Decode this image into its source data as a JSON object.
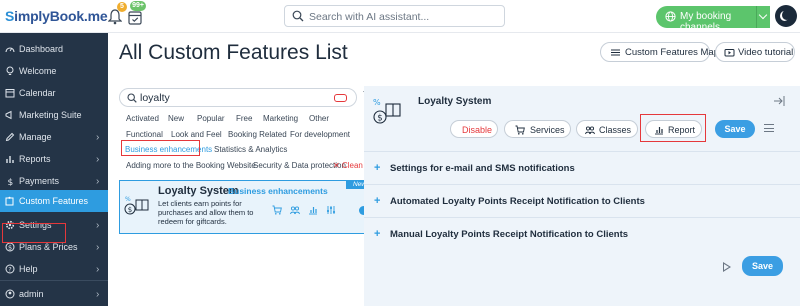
{
  "topbar": {
    "logo_prefix": "S",
    "logo_rest": "implyBook.me",
    "notifications_count": "5",
    "calendar_badge": "99+",
    "search_placeholder": "Search with AI assistant...",
    "channels_label": "My booking channels"
  },
  "sidebar": {
    "items": [
      {
        "label": "Dashboard",
        "icon": "dashboard-icon",
        "arrow": false
      },
      {
        "label": "Welcome",
        "icon": "lightbulb-icon",
        "arrow": false
      },
      {
        "label": "Calendar",
        "icon": "calendar-icon",
        "arrow": false
      },
      {
        "label": "Marketing Suite",
        "icon": "megaphone-icon",
        "arrow": false
      },
      {
        "label": "Manage",
        "icon": "pencil-icon",
        "arrow": true
      },
      {
        "label": "Reports",
        "icon": "chart-icon",
        "arrow": true
      },
      {
        "label": "Payments",
        "icon": "dollar-icon",
        "arrow": true
      },
      {
        "label": "Custom Features",
        "icon": "puzzle-icon",
        "arrow": false,
        "active": true
      },
      {
        "label": "Settings",
        "icon": "gear-icon",
        "arrow": true
      },
      {
        "label": "Plans & Prices",
        "icon": "dollar-circle-icon",
        "arrow": true
      },
      {
        "label": "Help",
        "icon": "help-icon",
        "arrow": true
      }
    ],
    "user": {
      "label": "admin",
      "icon": "user-icon"
    }
  },
  "main": {
    "title": "All Custom Features List",
    "map_button": "Custom Features Map",
    "video_button": "Video tutorial"
  },
  "filter": {
    "search_value": "loyalty",
    "tags_row1": [
      "Activated",
      "New",
      "Popular",
      "Free",
      "Marketing",
      "Other"
    ],
    "tags_row2": [
      "Functional",
      "Look and Feel",
      "Booking Related",
      "For development"
    ],
    "tags_row3": [
      "Business enhancements",
      "Statistics & Analytics"
    ],
    "tags_row4": [
      "Adding more to the Booking Website",
      "Security & Data protection"
    ],
    "selected_tag": "Business enhancements",
    "clean_label": "Clean"
  },
  "feature_card": {
    "badge": "New",
    "title": "Loyalty System",
    "category": "Business enhancements",
    "description": "Let clients earn points for purchases and allow them to redeem for giftcards.",
    "enabled": true
  },
  "detail": {
    "title": "Loyalty System",
    "buttons": {
      "disable": "Disable",
      "services": "Services",
      "classes": "Classes",
      "report": "Report",
      "save": "Save"
    },
    "sections": [
      "Settings for e-mail and SMS notifications",
      "Automated Loyalty Points Receipt Notification to Clients",
      "Manual Loyalty Points Receipt Notification to Clients"
    ],
    "bottom_save": "Save"
  },
  "colors": {
    "sidebar_bg": "#243447",
    "accent": "#2e9ce0",
    "green": "#5cc56c",
    "highlight_red": "#e5383b"
  }
}
